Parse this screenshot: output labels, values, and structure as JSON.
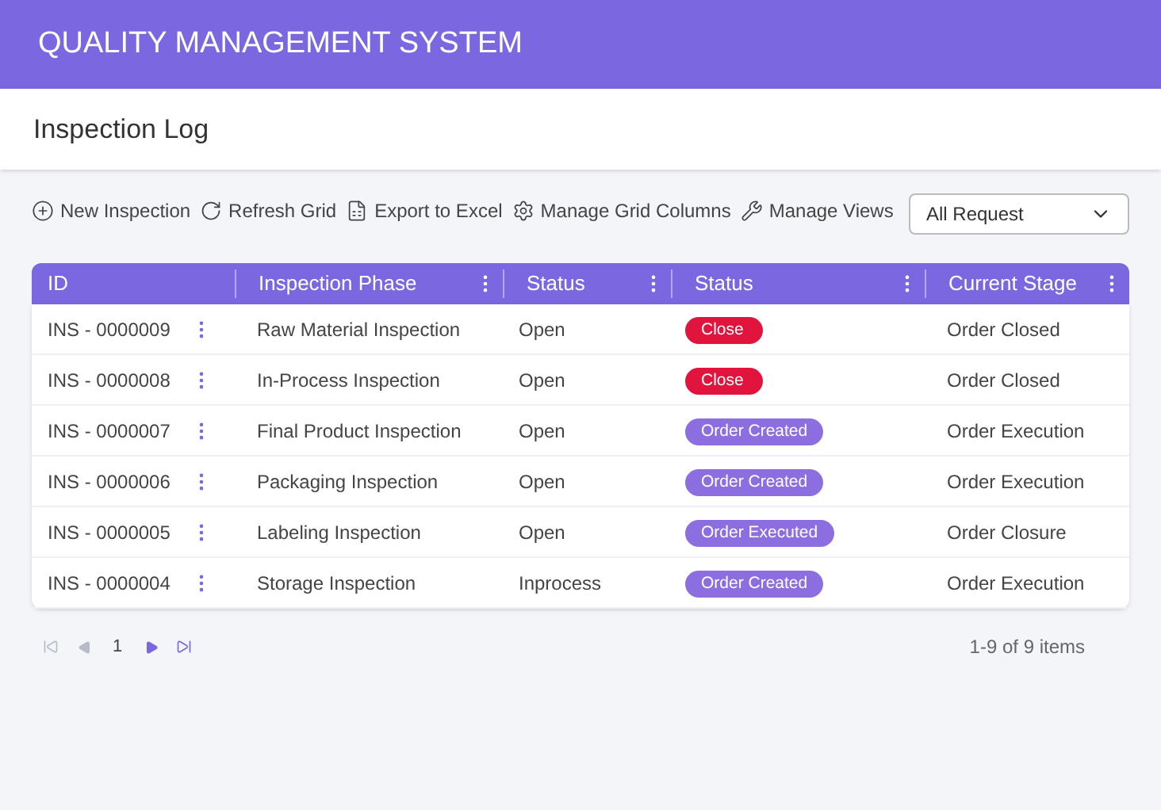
{
  "app_title": "QUALITY MANAGEMENT SYSTEM",
  "page_title": "Inspection Log",
  "toolbar": [
    {
      "kind": "add",
      "label": "New Inspection"
    },
    {
      "kind": "refresh",
      "label": "Refresh Grid"
    },
    {
      "kind": "excel",
      "label": "Export to Excel"
    },
    {
      "kind": "gear",
      "label": "Manage Grid Columns"
    },
    {
      "kind": "wrench",
      "label": "Manage Views"
    }
  ],
  "filter": {
    "value": "All Request"
  },
  "table": {
    "columns": [
      "ID",
      "Inspection Phase",
      "Status",
      "Status",
      "Current Stage"
    ],
    "rows": [
      {
        "id": "INS - 0000009",
        "phase": "Raw Material Inspection",
        "status": "Open",
        "badge": {
          "label": "Close",
          "color": "#e0143c"
        },
        "stage": "Order Closed"
      },
      {
        "id": "INS - 0000008",
        "phase": "In-Process Inspection",
        "status": "Open",
        "badge": {
          "label": "Close",
          "color": "#e0143c"
        },
        "stage": "Order Closed"
      },
      {
        "id": "INS - 0000007",
        "phase": "Final Product Inspection",
        "status": "Open",
        "badge": {
          "label": "Order Created",
          "color": "#8c6ee0"
        },
        "stage": "Order Execution"
      },
      {
        "id": "INS - 0000006",
        "phase": "Packaging Inspection",
        "status": "Open",
        "badge": {
          "label": "Order Created",
          "color": "#8c6ee0"
        },
        "stage": "Order Execution"
      },
      {
        "id": "INS - 0000005",
        "phase": "Labeling Inspection",
        "status": "Open",
        "badge": {
          "label": "Order Executed",
          "color": "#8c6ee0"
        },
        "stage": "Order Closure"
      },
      {
        "id": "INS - 0000004",
        "phase": "Storage Inspection",
        "status": "Inprocess",
        "badge": {
          "label": "Order Created",
          "color": "#8c6ee0"
        },
        "stage": "Order Execution"
      }
    ]
  },
  "pager": {
    "first": {
      "disabled": true
    },
    "prev": {
      "disabled": true
    },
    "page": "1",
    "next": {
      "disabled": false
    },
    "last": {
      "disabled": false
    },
    "summary": "1-9 of 9 items"
  }
}
